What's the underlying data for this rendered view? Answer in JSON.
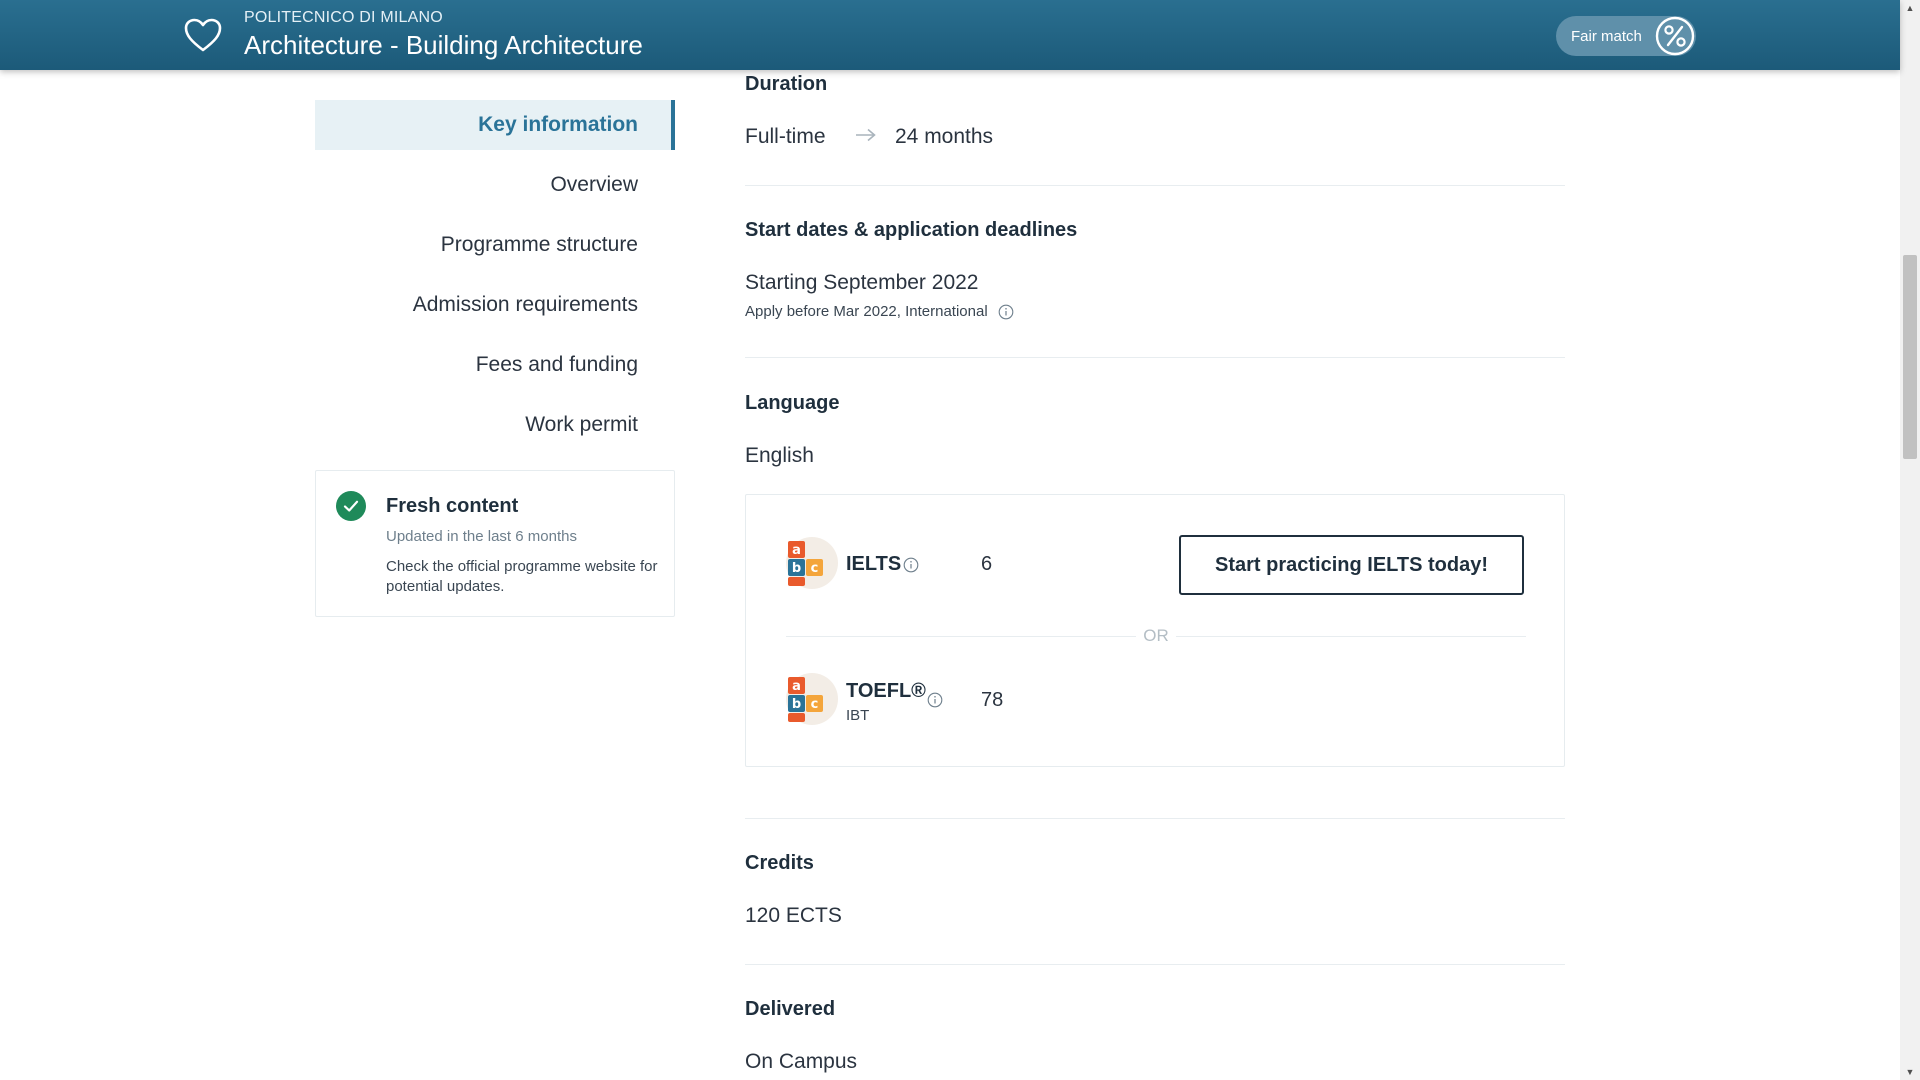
{
  "header": {
    "university": "POLITECNICO DI MILANO",
    "programme": "Architecture - Building Architecture",
    "match_label": "Fair match",
    "favorite_icon": "heart-icon",
    "match_icon": "percent-icon"
  },
  "sidebar": {
    "items": [
      {
        "label": "Key information",
        "active": true
      },
      {
        "label": "Overview"
      },
      {
        "label": "Programme structure"
      },
      {
        "label": "Admission requirements"
      },
      {
        "label": "Fees and funding"
      },
      {
        "label": "Work permit"
      }
    ],
    "fresh": {
      "title": "Fresh content",
      "subtitle": "Updated in the last 6 months",
      "note": "Check the official programme website for potential updates."
    }
  },
  "duration": {
    "title": "Duration",
    "pace": "Full-time",
    "length": "24 months"
  },
  "start": {
    "title": "Start dates & application deadlines",
    "starting": "Starting September 2022",
    "deadline": "Apply before Mar 2022, International"
  },
  "language": {
    "title": "Language",
    "value": "English",
    "or_label": "OR",
    "tests": [
      {
        "name": "IELTS",
        "sub": "",
        "score": "6"
      },
      {
        "name": "TOEFL®",
        "sub": "IBT",
        "score": "78"
      }
    ],
    "cta_label": "Start practicing IELTS today!"
  },
  "credits": {
    "title": "Credits",
    "value": "120 ECTS"
  },
  "delivered": {
    "title": "Delivered",
    "value": "On Campus"
  },
  "colors": {
    "header": "#1c5a79",
    "accent": "#2a7398",
    "fresh_check": "#1f8a5a"
  }
}
